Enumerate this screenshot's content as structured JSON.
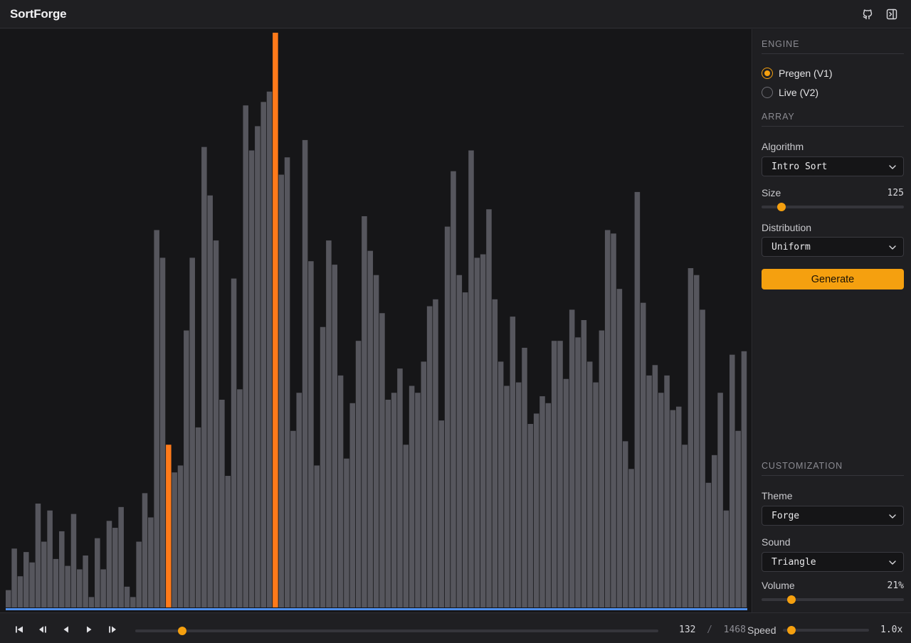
{
  "app": {
    "title": "SortForge"
  },
  "header": {
    "icons": [
      "github-icon",
      "sidebar-toggle-icon"
    ]
  },
  "colors": {
    "accent": "#f5a00f",
    "bar": "#56565d",
    "highlight": "#ff7a1a",
    "progress": "#4f8fea",
    "background": "#161618"
  },
  "visualization": {
    "bar_count": 125,
    "max_value": 125,
    "values": [
      5,
      17,
      9,
      16,
      13,
      30,
      19,
      28,
      14,
      22,
      12,
      27,
      11,
      15,
      3,
      20,
      11,
      25,
      23,
      29,
      6,
      3,
      19,
      33,
      26,
      109,
      101,
      47,
      39,
      41,
      80,
      101,
      52,
      133,
      119,
      106,
      60,
      38,
      95,
      63,
      145,
      132,
      139,
      146,
      149,
      166,
      125,
      130,
      51,
      62,
      135,
      100,
      41,
      81,
      106,
      99,
      67,
      43,
      59,
      77,
      113,
      103,
      96,
      85,
      60,
      62,
      69,
      47,
      64,
      62,
      71,
      87,
      89,
      54,
      110,
      126,
      96,
      91,
      132,
      101,
      102,
      115,
      89,
      71,
      64,
      84,
      65,
      75,
      53,
      56,
      61,
      59,
      77,
      77,
      66,
      86,
      78,
      83,
      71,
      65,
      80,
      109,
      108,
      92,
      48,
      40,
      120,
      88,
      67,
      70,
      62,
      67,
      57,
      58,
      47,
      98,
      96,
      86,
      36,
      44,
      62,
      28,
      73,
      51,
      74
    ],
    "highlighted_indices": [
      27,
      45
    ],
    "sorted_upto": 125,
    "progress": 1.0
  },
  "sidebar": {
    "engine": {
      "title": "ENGINE",
      "options": [
        {
          "label": "Pregen (V1)",
          "selected": true
        },
        {
          "label": "Live (V2)",
          "selected": false
        }
      ]
    },
    "array": {
      "title": "ARRAY",
      "algorithm_label": "Algorithm",
      "algorithm_value": "Intro Sort",
      "size_label": "Size",
      "size_value": "125",
      "size_fraction": 0.14,
      "distribution_label": "Distribution",
      "distribution_value": "Uniform",
      "generate_label": "Generate"
    },
    "customization": {
      "title": "CUSTOMIZATION",
      "theme_label": "Theme",
      "theme_value": "Forge",
      "sound_label": "Sound",
      "sound_value": "Triangle",
      "volume_label": "Volume",
      "volume_value": "21%",
      "volume_fraction": 0.21
    }
  },
  "playback": {
    "icons": [
      "skip-start-icon",
      "step-back-icon",
      "play-back-icon",
      "play-icon",
      "step-forward-icon"
    ],
    "step_current": "132",
    "step_total": "1468",
    "step_fraction": 0.09,
    "speed_label": "Speed",
    "speed_value": "1.0x",
    "speed_fraction": 0.1
  }
}
